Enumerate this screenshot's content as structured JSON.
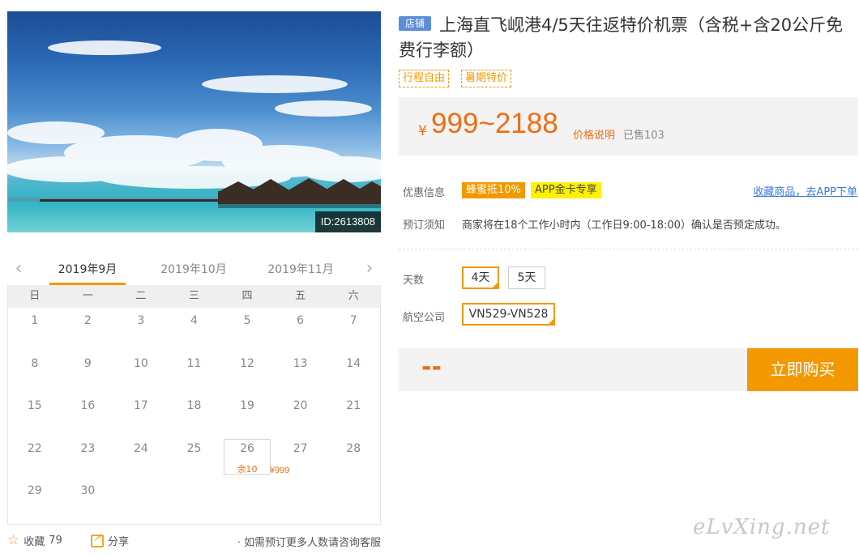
{
  "photo": {
    "id_label": "ID:2613808"
  },
  "calendar": {
    "months": [
      "2019年9月",
      "2019年10月",
      "2019年11月"
    ],
    "prev_icon": "chevron-left-icon",
    "next_icon": "chevron-right-icon",
    "weekdays": [
      "日",
      "一",
      "二",
      "三",
      "四",
      "五",
      "六"
    ],
    "days": [
      {
        "d": "1"
      },
      {
        "d": "2"
      },
      {
        "d": "3"
      },
      {
        "d": "4"
      },
      {
        "d": "5"
      },
      {
        "d": "6"
      },
      {
        "d": "7"
      },
      {
        "d": "8"
      },
      {
        "d": "9"
      },
      {
        "d": "10"
      },
      {
        "d": "11"
      },
      {
        "d": "12"
      },
      {
        "d": "13"
      },
      {
        "d": "14"
      },
      {
        "d": "15"
      },
      {
        "d": "16"
      },
      {
        "d": "17"
      },
      {
        "d": "18"
      },
      {
        "d": "19"
      },
      {
        "d": "20"
      },
      {
        "d": "21"
      },
      {
        "d": "22"
      },
      {
        "d": "23"
      },
      {
        "d": "24"
      },
      {
        "d": "25"
      },
      {
        "d": "26",
        "price": "¥999",
        "remain": "余10"
      },
      {
        "d": "27"
      },
      {
        "d": "28"
      },
      {
        "d": "29"
      },
      {
        "d": "30"
      }
    ]
  },
  "bottom": {
    "favorite_label": "收藏",
    "favorite_count": "79",
    "share_label": "分享",
    "consult_text": "· 如需预订更多人数请咨询客服"
  },
  "product": {
    "shop_badge": "店铺",
    "title": "上海直飞岘港4/5天往返特价机票（含税+含20公斤免费行李额）",
    "tags": [
      "行程自由",
      "暑期特价"
    ],
    "currency": "¥",
    "price_range": "999~2188",
    "price_note": "价格说明",
    "sold": "已售103"
  },
  "info": {
    "promo_label": "优惠信息",
    "promo_tags": [
      "蜂蜜抵10%",
      "APP金卡专享"
    ],
    "app_link": "收藏商品，去APP下单",
    "notice_label": "预订须知",
    "notice_text": "商家将在18个工作小时内（工作日9:00-18:00）确认是否预定成功。"
  },
  "options": {
    "days_label": "天数",
    "days": [
      "4天",
      "5天"
    ],
    "days_selected": "4天",
    "airline_label": "航空公司",
    "airlines": [
      "VN529-VN528"
    ],
    "airline_selected": "VN529-VN528"
  },
  "buy": {
    "price": "--",
    "button": "立即购买"
  },
  "watermark": "eLvXing.net",
  "colors": {
    "accent": "#f39800",
    "price": "#ee6d13",
    "badge": "#5b8dd9",
    "link": "#3a7bd5"
  }
}
